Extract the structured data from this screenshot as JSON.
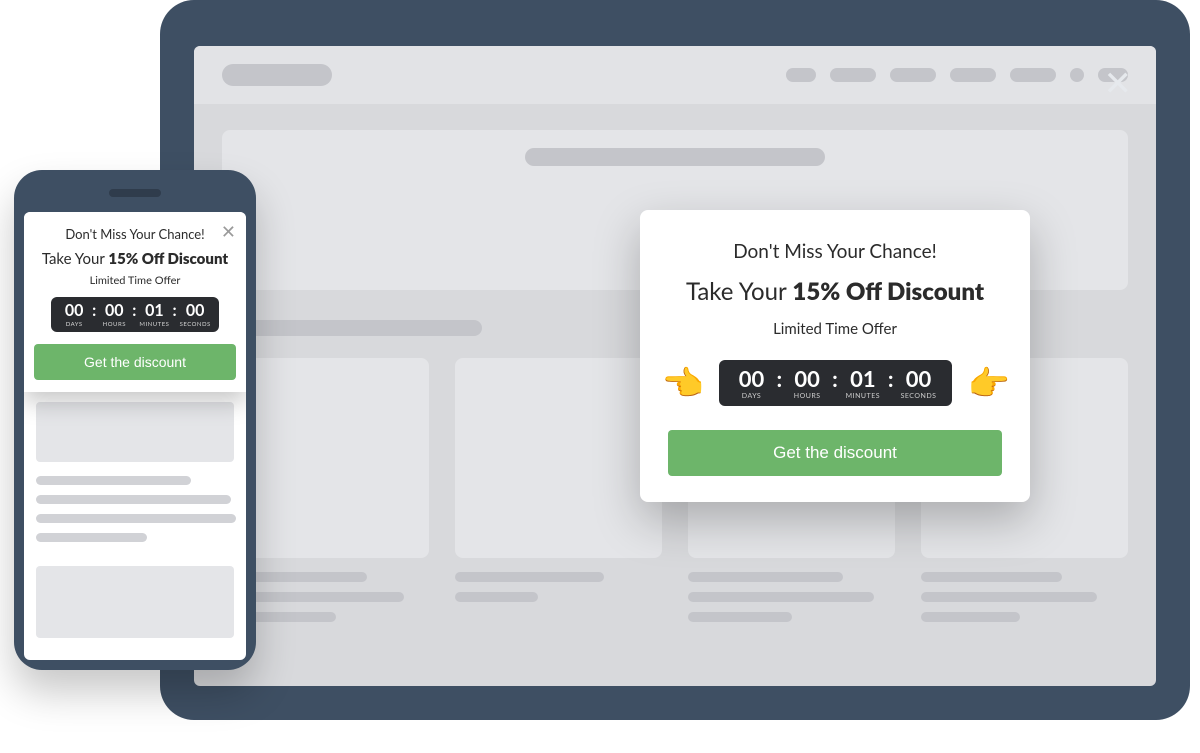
{
  "popup": {
    "title": "Don't Miss Your Chance!",
    "headline_prefix": "Take Your ",
    "headline_bold": "15% Off Discount",
    "subtext": "Limited Time Offer",
    "cta_label": "Get the discount"
  },
  "countdown": {
    "days": {
      "value": "00",
      "label": "DAYS"
    },
    "hours": {
      "value": "00",
      "label": "HOURS"
    },
    "minutes": {
      "value": "01",
      "label": "MINUTES"
    },
    "seconds": {
      "value": "00",
      "label": "SECONDS"
    }
  },
  "icons": {
    "close_glyph": "✕",
    "pointer_glyph": "👉"
  },
  "colors": {
    "device_frame": "#3e4f63",
    "cta_green": "#6db56a",
    "timer_bg": "#2a2c30"
  }
}
